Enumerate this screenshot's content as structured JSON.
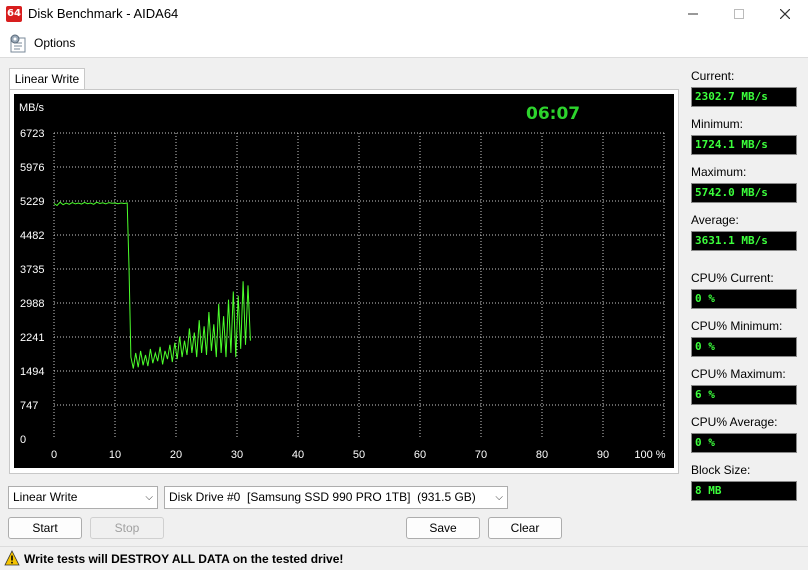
{
  "window": {
    "title": "Disk Benchmark - AIDA64",
    "icon_text": "64"
  },
  "menu": {
    "options_label": "Options"
  },
  "tab": {
    "label": "Linear Write"
  },
  "colors": {
    "line": "#4cff2c",
    "grid": "#c8c8c8",
    "timer": "#2dd42d",
    "value_text": "#3cff3c"
  },
  "chart": {
    "timer": "06:07",
    "unit_label": "MB/s",
    "percent_label": "100 %"
  },
  "chart_data": {
    "type": "line",
    "ylabel": "MB/s",
    "ylim": [
      0,
      7470
    ],
    "xlim": [
      0,
      100
    ],
    "y_ticks": [
      "6723",
      "5976",
      "5229",
      "4482",
      "3735",
      "2988",
      "2241",
      "1494",
      "747",
      "0"
    ],
    "x_ticks": [
      "0",
      "10",
      "20",
      "30",
      "40",
      "50",
      "60",
      "70",
      "80",
      "90",
      "100 %"
    ],
    "grid": true,
    "series": [
      {
        "x": [
          0,
          0.5,
          1,
          1.5,
          2,
          2.5,
          3,
          3.5,
          4,
          4.5,
          5,
          5.5,
          6,
          6.5,
          7,
          7.5,
          8,
          8.5,
          9,
          9.5,
          10,
          10.5,
          11,
          11.5,
          12,
          12.3,
          12.6,
          13,
          13.4,
          13.8,
          14.2,
          14.6,
          15,
          15.4,
          15.8,
          16.2,
          16.6,
          17,
          17.4,
          17.8,
          18.2,
          18.6,
          19,
          19.4,
          19.8,
          20.2,
          20.6,
          21,
          21.4,
          21.8,
          22.2,
          22.6,
          23,
          23.4,
          23.8,
          24.2,
          24.6,
          25,
          25.4,
          25.8,
          26.2,
          26.6,
          27,
          27.4,
          27.8,
          28.2,
          28.6,
          29,
          29.4,
          29.8,
          30.2,
          30.6,
          31,
          31.4,
          31.8,
          32.2
        ],
        "y": [
          5750,
          5700,
          5780,
          5720,
          5760,
          5730,
          5770,
          5740,
          5760,
          5735,
          5775,
          5745,
          5760,
          5730,
          5780,
          5750,
          5765,
          5740,
          5770,
          5755,
          5760,
          5745,
          5760,
          5750,
          5760,
          4200,
          2000,
          1720,
          2100,
          1750,
          2150,
          1800,
          2050,
          1780,
          2200,
          1850,
          2100,
          1900,
          2250,
          1820,
          2150,
          1950,
          2300,
          1880,
          2350,
          1950,
          2500,
          2000,
          2400,
          2050,
          2700,
          2100,
          2600,
          2000,
          2900,
          2100,
          2750,
          2050,
          3100,
          2150,
          2800,
          2000,
          3300,
          2100,
          3000,
          2000,
          3400,
          2100,
          3600,
          2000,
          3500,
          2200,
          3850,
          2300,
          3750,
          2400
        ]
      }
    ]
  },
  "stats": [
    {
      "label": "Current:",
      "value": "2302.7 MB/s"
    },
    {
      "label": "Minimum:",
      "value": "1724.1 MB/s"
    },
    {
      "label": "Maximum:",
      "value": "5742.0 MB/s"
    },
    {
      "label": "Average:",
      "value": "3631.1 MB/s"
    },
    {
      "label": "CPU% Current:",
      "value": "0 %"
    },
    {
      "label": "CPU% Minimum:",
      "value": "0 %"
    },
    {
      "label": "CPU% Maximum:",
      "value": "6 %"
    },
    {
      "label": "CPU% Average:",
      "value": "0 %"
    },
    {
      "label": "Block Size:",
      "value": "8 MB"
    }
  ],
  "controls": {
    "test_select": "Linear Write",
    "drive_select": "Disk Drive #0  [Samsung SSD 990 PRO 1TB]  (931.5 GB)",
    "start_label": "Start",
    "stop_label": "Stop",
    "save_label": "Save",
    "clear_label": "Clear"
  },
  "status": {
    "warning": "Write tests will DESTROY ALL DATA on the tested drive!"
  }
}
